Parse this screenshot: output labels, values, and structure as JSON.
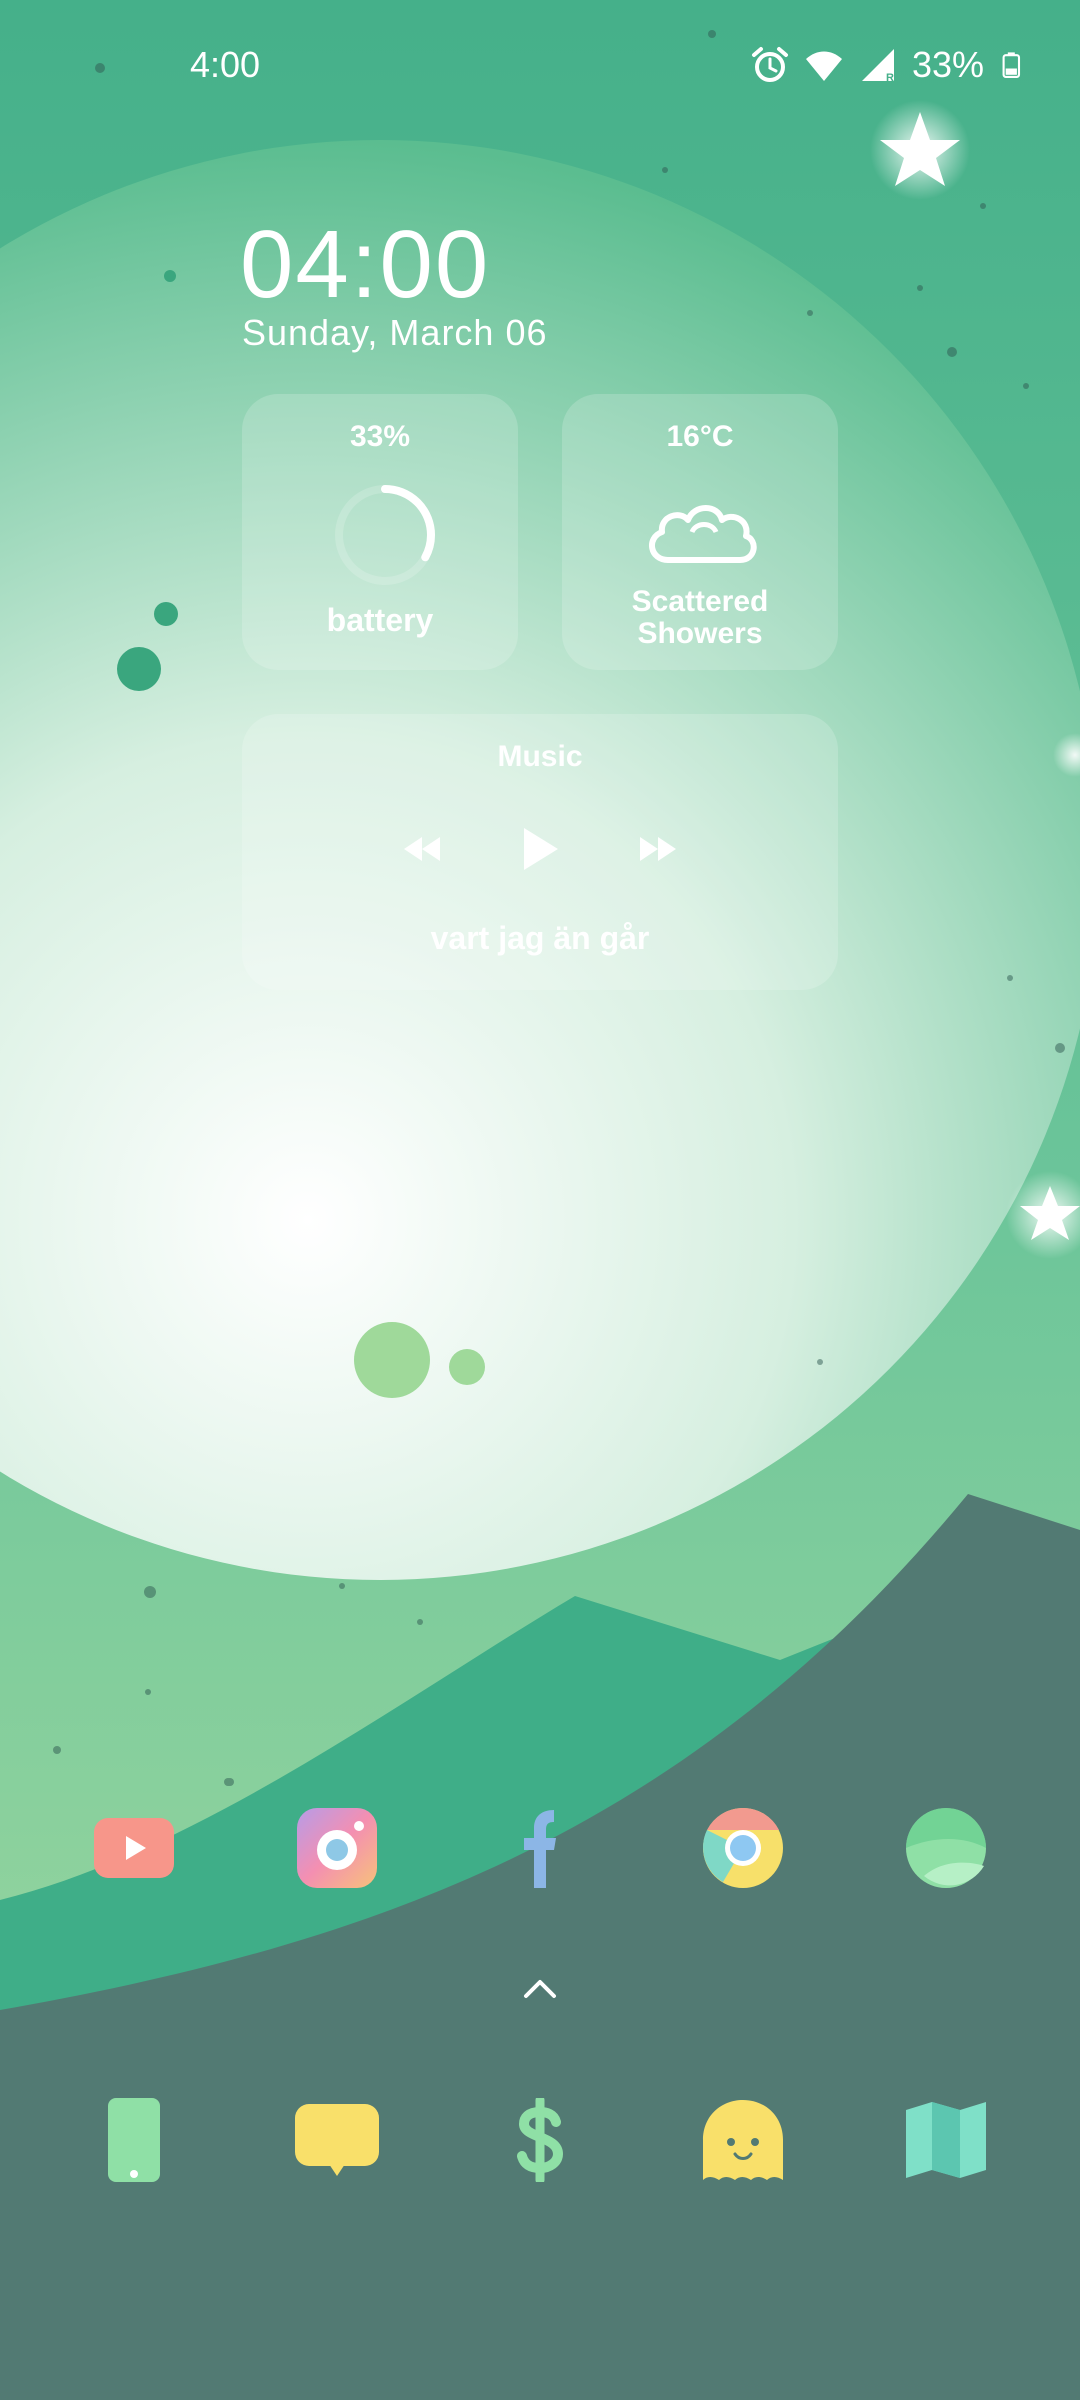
{
  "status_bar": {
    "time": "4:00",
    "battery_percent": "33%",
    "icons": [
      "alarm-icon",
      "wifi-icon",
      "signal-icon",
      "battery-icon"
    ]
  },
  "clock_widget": {
    "time": "04:00",
    "date": "Sunday, March 06"
  },
  "battery_widget": {
    "percent": "33%",
    "label": "battery",
    "level": 0.33
  },
  "weather_widget": {
    "temperature": "16°C",
    "condition_line1": "Scattered",
    "condition_line2": "Showers",
    "icon": "cloud-icon"
  },
  "music_widget": {
    "title": "Music",
    "track": "vart jag än går",
    "controls": [
      "rewind-icon",
      "play-icon",
      "fast-forward-icon"
    ]
  },
  "home_apps": [
    "youtube-icon",
    "camera-icon",
    "facebook-icon",
    "chrome-icon",
    "browser-icon"
  ],
  "dock_apps": [
    "phone-icon",
    "messages-icon",
    "wallet-icon",
    "ghost-icon",
    "maps-icon"
  ],
  "colors": {
    "sky": "#45b08a",
    "planet": "#d9f0e2",
    "hill": "#527a73",
    "accent_green": "#7be0a8",
    "accent_yellow": "#f9e06a"
  }
}
